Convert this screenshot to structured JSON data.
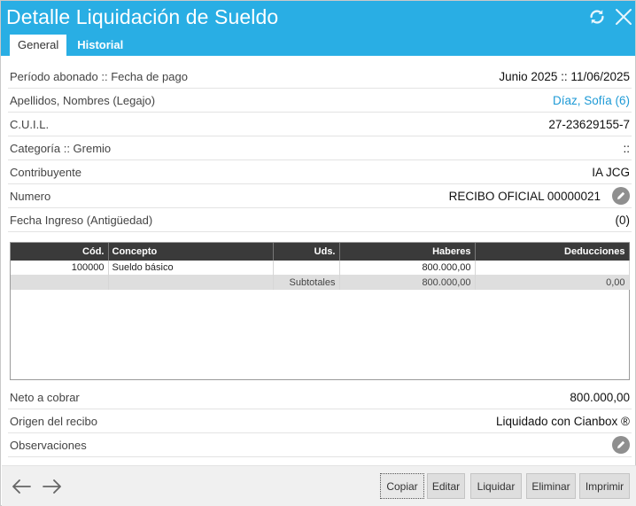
{
  "window": {
    "title": "Detalle Liquidación de Sueldo",
    "tabs": [
      {
        "label": "General",
        "active": true
      },
      {
        "label": "Historial",
        "active": false
      }
    ],
    "icons": {
      "refresh": "refresh-icon",
      "close": "close-icon"
    }
  },
  "details": {
    "periodo": {
      "label": "Período abonado :: Fecha de pago",
      "value": "Junio 2025 :: 11/06/2025"
    },
    "empleado": {
      "label": "Apellidos, Nombres (Legajo)",
      "value": "Díaz, Sofía (6)"
    },
    "cuil": {
      "label": "C.U.I.L.",
      "value": "27-23629155-7"
    },
    "categoria": {
      "label": "Categoría :: Gremio",
      "value": "::"
    },
    "contribuyente": {
      "label": "Contribuyente",
      "value": "IA JCG"
    },
    "numero": {
      "label": "Numero",
      "value": "RECIBO OFICIAL 00000021"
    },
    "ingreso": {
      "label": "Fecha Ingreso (Antigüedad)",
      "value": "(0)"
    }
  },
  "conceptos": {
    "headers": {
      "cod": "Cód.",
      "concepto": "Concepto",
      "uds": "Uds.",
      "haberes": "Haberes",
      "deducciones": "Deducciones"
    },
    "rows": [
      {
        "cod": "100000",
        "concepto": "Sueldo básico",
        "uds": "",
        "haberes": "800.000,00",
        "deducciones": ""
      }
    ],
    "subtotal": {
      "label": "Subtotales",
      "haberes": "800.000,00",
      "deducciones": "0,00"
    }
  },
  "summary": {
    "neto": {
      "label": "Neto a cobrar",
      "value": "800.000,00"
    },
    "origen": {
      "label": "Origen del recibo",
      "value": "Liquidado con Cianbox ®"
    },
    "observaciones": {
      "label": "Observaciones",
      "value": ""
    }
  },
  "footer": {
    "buttons": {
      "copiar": "Copiar",
      "editar": "Editar",
      "liquidar": "Liquidar",
      "eliminar": "Eliminar",
      "imprimir": "Imprimir"
    }
  },
  "colors": {
    "header": "#29aee4",
    "link": "#1e9ad6",
    "table_header": "#3a3a3a"
  }
}
